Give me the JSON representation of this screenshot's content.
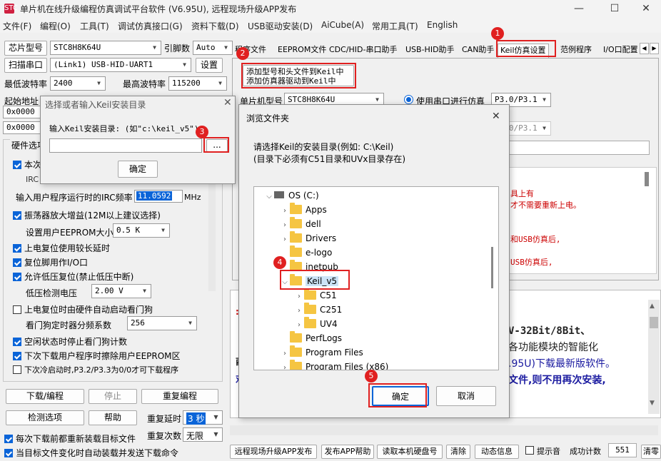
{
  "window": {
    "title": "单片机在线升级编程仿真调试平台软件 (V6.95U), 远程现场升级APP发布",
    "app_icon": "STC"
  },
  "menu": [
    "文件(F)",
    "编程(O)",
    "工具(T)",
    "调试仿真接口(G)",
    "资料下载(D)",
    "USB驱动安装(D)",
    "AiCube(A)",
    "常用工具(T)",
    "English"
  ],
  "left": {
    "chip_label": "芯片型号",
    "chip_value": "STC8H8K64U",
    "pin_label": "引脚数",
    "pin_value": "Auto",
    "scan_label": "扫描串口",
    "port_value": "(Link1) USB-HID-UART1",
    "settings_label": "设置",
    "min_baud_label": "最低波特率",
    "min_baud": "2400",
    "max_baud_label": "最高波特率",
    "max_baud": "115200",
    "start_addr_label": "起始地址",
    "addr1": "0x0000",
    "addr2": "0x0000",
    "hw_label": "硬件选项",
    "irc_label": "输入用户程序运行时的IRC频率",
    "irc_value": "11.0592",
    "irc_unit": "MHz",
    "osc_label": "振荡器放大增益(12M以上建议选择)",
    "eeprom_label": "设置用户EEPROM大小",
    "eeprom_value": "0.5 K",
    "delay_label": "上电复位使用较长延时",
    "reset_io_label": "复位脚用作I/O口",
    "lvr_label": "允许低压复位(禁止低压中断)",
    "lvd_label": "低压检测电压",
    "lvd_value": "2.00 V",
    "wdt_label": "上电复位时由硬件自动启动看门狗",
    "wdt_div_label": "看门狗定时器分频系数",
    "wdt_div_value": "256",
    "idle_wdt_label": "空闲状态时停止看门狗计数",
    "eeprom_erase_label": "下次下载用户程序时擦除用户EEPROM区",
    "p32_label": "下次冷启动时,P3.2/P3.3为0/0才可下载程序",
    "download_label": "下载/编程",
    "stop_label": "停止",
    "reprogram_label": "重复编程",
    "detect_label": "检测选项",
    "help_label": "帮助",
    "repeat_delay_label": "重复延时",
    "repeat_delay_value": "3 秒",
    "repeat_count_label": "重复次数",
    "repeat_count_value": "无限",
    "reload_label": "每次下载前都重新装载目标文件",
    "autoload_label": "当目标文件变化时自动装载并发送下载命令"
  },
  "tabs": [
    "程序文件",
    "EEPROM文件",
    "CDC/HID-串口助手",
    "USB-HID助手",
    "CAN助手",
    "Keil仿真设置",
    "范例程序",
    "I/O口配置"
  ],
  "keil_panel": {
    "add_line1": "添加型号和头文件到Keil中",
    "add_line2": "添加仿真器驱动到Keil中",
    "chip_label": "单片机型号",
    "chip_value": "STC8H8K64U",
    "serial_sim_label": "使用串口进行仿真",
    "serial_port_value": "P3.0/P3.1",
    "serial_port_value2": "P3.0/P3.1",
    "note_lines": [
      "具上有",
      "才不需要重新上电。",
      "和USB仿真后,",
      "USB仿真后,"
    ]
  },
  "lower_text": [
    "V-32Bit/8Bit、",
    "各功能模块的智能化",
    ".95U)下载最新版软件。",
    "文件,则不用再次安装,"
  ],
  "bottom": {
    "remote_label": "远程现场升级APP发布",
    "publish_help_label": "发布APP帮助",
    "read_disk_label": "读取本机硬盘号",
    "clear_label": "清除",
    "dynamic_label": "动态信息",
    "beep_label": "提示音",
    "success_label": "成功计数",
    "success_value": "551",
    "reset_label": "清零"
  },
  "keil_dialog": {
    "title": "选择或者输入Keil安装目录",
    "prompt": "输入Keil安装目录: (如\"c:\\keil_v5\")",
    "browse_label": "...",
    "ok_label": "确定"
  },
  "browse_dialog": {
    "title": "浏览文件夹",
    "desc1": "请选择Keil的安装目录(例如: C:\\Keil)",
    "desc2": "(目录下必须有C51目录和UVx目录存在)",
    "tree": [
      "OS (C:)",
      "Apps",
      "dell",
      "Drivers",
      "e-logo",
      "inetpub",
      "Keil_v5",
      "C51",
      "C251",
      "UV4",
      "PerfLogs",
      "Program Files",
      "Program Files (x86)"
    ],
    "ok_label": "确定",
    "cancel_label": "取消"
  },
  "badges": [
    "1",
    "2",
    "3",
    "4",
    "5"
  ],
  "colors": {
    "accent": "#0a64d8",
    "highlight": "#e02020",
    "blue_text": "#1a1aa0",
    "red_text": "#cc0000"
  }
}
